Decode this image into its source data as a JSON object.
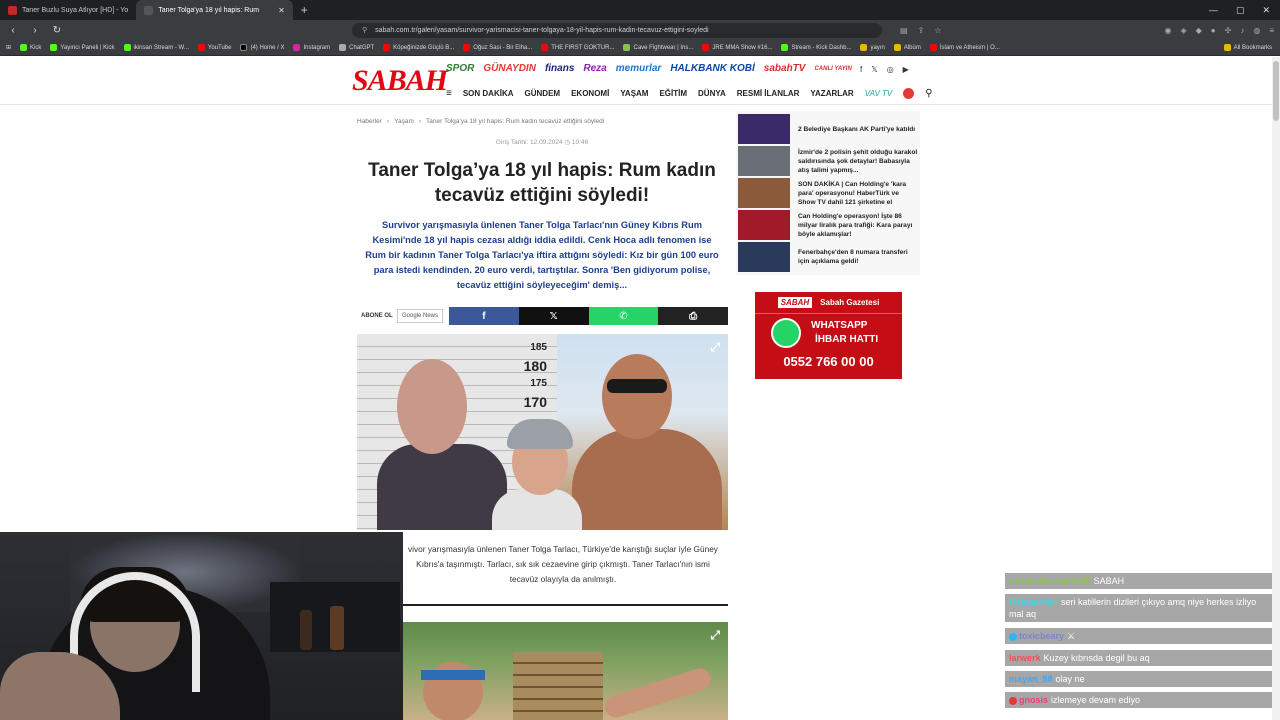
{
  "browser": {
    "tabs": [
      {
        "title": "Taner Buzlu Suya Atlıyor [HD] - Yo",
        "active": false
      },
      {
        "title": "Taner Tolga'ya 18 yıl hapis: Rum",
        "active": true
      }
    ],
    "url": "sabah.com.tr/galeri/yasam/survivor-yarismacisi-taner-tolgaya-18-yil-hapis-rum-kadin-tecavuz-ettigini-soyledi",
    "bookmarks": [
      "Kick",
      "Yayıncı Paneli | Kick",
      "ikinsan Stream - W...",
      "YouTube",
      "(4) Home / X",
      "Instagram",
      "ChatGPT",
      "Köpeğinizde Güçlü B...",
      "Oğuz Sasi - Bir Elha...",
      "THE FIRST GOKTUR...",
      "Cave Fightwear | Ins...",
      "JRE MMA Show #16...",
      "Stream - Kick Dashb...",
      "yayın",
      "Albüm",
      "İslam ve Atheism | O..."
    ],
    "all_bookmarks": "All Bookmarks"
  },
  "site": {
    "logo": "SABAH",
    "brands": [
      {
        "label": "SPOR",
        "color": "#2e7d32"
      },
      {
        "label": "GÜNAYDIN",
        "color": "#e53935"
      },
      {
        "label": "finans",
        "color": "#1a237e"
      },
      {
        "label": "Reza",
        "color": "#8e24aa"
      },
      {
        "label": "memurlar",
        "color": "#1976d2"
      },
      {
        "label": "HALKBANK KOBİ",
        "color": "#0d47a1"
      },
      {
        "label": "sabahTV",
        "color": "#d32f2f"
      },
      {
        "label": "CANLI YAYIN",
        "color": "#d32f2f"
      }
    ],
    "social": [
      "f",
      "𝕏",
      "◎",
      "▶"
    ],
    "nav": [
      "SON DAKİKA",
      "GÜNDEM",
      "EKONOMİ",
      "YAŞAM",
      "EĞİTİM",
      "DÜNYA",
      "RESMİ İLANLAR",
      "YAZARLAR",
      "VAV TV"
    ]
  },
  "article": {
    "breadcrumb": [
      "Haberler",
      "Yaşam",
      "Taner Tolga'ya 18 yıl hapis: Rum kadın tecavüz ettiğini söyledi"
    ],
    "pubdate_label": "Giriş Tarihi: 12.09.2024",
    "pubtime": "10:46",
    "headline": "Taner Tolga’ya 18 yıl hapis: Rum kadın tecavüz ettiğini söyledi!",
    "summary": "Survivor yarışmasıyla ünlenen Taner Tolga Tarlacı'nın Güney Kıbrıs Rum Kesimi'nde 18 yıl hapis cezası aldığı iddia edildi. Cenk Hoca adlı fenomen ise Rum bir kadının Taner Tolga Tarlacı'ya iftira attığını söyledi: Kız bir gün 100 euro para istedi kendinden. 20 euro verdi, tartıştılar. Sonra 'Ben gidiyorum polise, tecavüz ettiğini söyleyeceğim' demiş...",
    "subscribe_label": "ABONE OL",
    "google_news": "Google News",
    "share": {
      "facebook": "f",
      "x": "𝕏",
      "whatsapp": "✆",
      "print": "⎙"
    },
    "mugshot_marks": [
      "185",
      "180",
      "175",
      "170"
    ],
    "caption": "vivor yarışmasıyla ünlenen Taner Tolga Tarlacı, Türkiye'de karıştığı suçlar iyle Güney Kıbrıs'a taşınmıştı. Tarlacı, sık sık cezaevine girip çıkmıştı. Taner Tarlacı'nın ismi tecavüz olayıyla da anılmıştı."
  },
  "sidebar": {
    "related": [
      {
        "title": "2 Belediye Başkanı AK Parti'ye katıldı",
        "color": "#3a2a6a"
      },
      {
        "title": "İzmir'de 2 polisin şehit olduğu karakol saldırısında şok detaylar! Babasıyla atış talimi yapmış...",
        "color": "#6a6f75"
      },
      {
        "title": "SON DAKİKA | Can Holding'e 'kara para' operasyonu! HaberTürk ve Show TV dahil 121 şirketine el",
        "color": "#8a5a3a"
      },
      {
        "title": "Can Holding'e operasyon! İşte 86 milyar liralık para trafiği: Kara parayı böyle aklamışlar!",
        "color": "#a01a2a"
      },
      {
        "title": "Fenerbahçe'den 8 numara transferi için açıklama geldi!",
        "color": "#2a3a5a"
      }
    ],
    "ad": {
      "logo": "SABAH",
      "brand": "Sabah Gazetesi",
      "line1": "WHATSAPP",
      "line2": "İHBAR HATTI",
      "phone": "0552 766 00 00"
    }
  },
  "chat": [
    {
      "user": "faelwasiwelaw2453",
      "text": "SABAH",
      "color": "#8bc34a",
      "badge": false,
      "badge_color": ""
    },
    {
      "user": "Oslasander",
      "text": "seri katillerin dizileri çıkıyo amq niye herkes izliyo mal aq",
      "color": "#4dd0e1",
      "badge": false,
      "badge_color": ""
    },
    {
      "user": "toxicbeary",
      "text": "⚔",
      "color": "#7986cb",
      "badge": true,
      "badge_color": "#29b6f6"
    },
    {
      "user": "larwerk",
      "text": "Kuzey kıbrısda degil bu aq",
      "color": "#ef5350",
      "badge": false,
      "badge_color": ""
    },
    {
      "user": "mayan_88",
      "text": "olay ne",
      "color": "#42a5f5",
      "badge": false,
      "badge_color": ""
    },
    {
      "user": "gnosis",
      "text": "izlemeye devam ediyo",
      "color": "#ec407a",
      "badge": true,
      "badge_color": "#e53935"
    }
  ]
}
